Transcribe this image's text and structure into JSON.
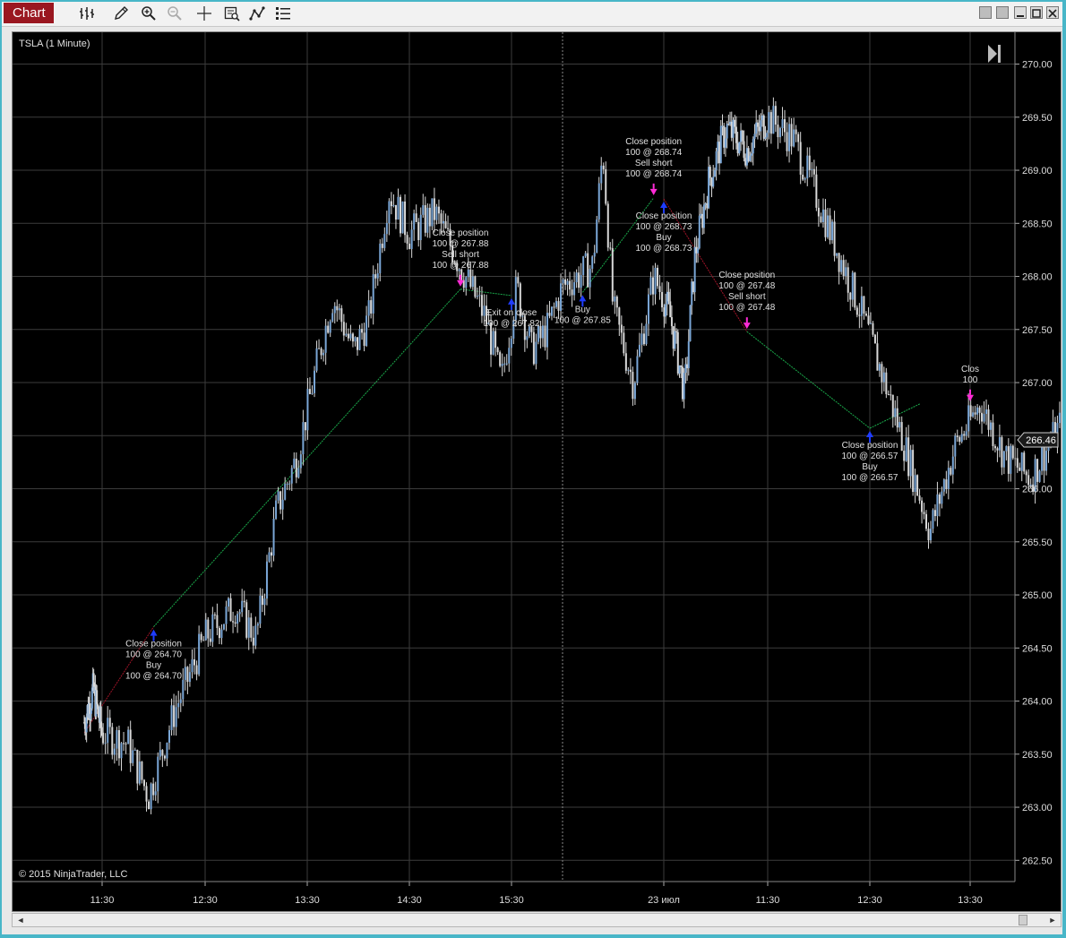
{
  "window": {
    "tab_label": "Chart",
    "toolbar_icons": [
      "bar-type-icon",
      "draw-pencil-icon",
      "zoom-in-icon",
      "zoom-out-icon",
      "crosshair-icon",
      "data-box-icon",
      "strategies-icon",
      "properties-icon"
    ],
    "controls": [
      "color-swatch-icon",
      "color-swatch-icon",
      "minimize-icon",
      "maximize-icon",
      "close-icon"
    ]
  },
  "chart": {
    "instrument_label": "TSLA (1 Minute)",
    "copyright": "© 2015 NinjaTrader, LLC",
    "current_price": "266.46",
    "price_ticks": [
      "270.00",
      "269.50",
      "269.00",
      "268.50",
      "268.00",
      "267.50",
      "267.00",
      "266.50",
      "266.00",
      "265.50",
      "265.00",
      "264.50",
      "264.00",
      "263.50",
      "263.00",
      "262.50"
    ],
    "time_ticks": [
      "11:30",
      "12:30",
      "13:30",
      "14:30",
      "15:30",
      "23 июл",
      "11:30",
      "12:30",
      "13:30"
    ],
    "colors": {
      "background": "#000000",
      "candle_body": "#7aa6d6",
      "wick": "#d8d8d8",
      "buy_marker": "#1f3cff",
      "sell_marker": "#ff2bd6",
      "winning_trade": "#1aa84a",
      "losing_trade": "#a01428",
      "text": "#e0e0e0"
    }
  },
  "chart_data": {
    "type": "candlestick",
    "instrument": "TSLA",
    "interval": "1 Minute",
    "ylim": [
      262.3,
      270.3
    ],
    "y_ticks": [
      262.5,
      263.0,
      263.5,
      264.0,
      264.5,
      265.0,
      265.5,
      266.0,
      266.5,
      267.0,
      267.5,
      268.0,
      268.5,
      269.0,
      269.5,
      270.0
    ],
    "price_path": [
      [
        11.0,
        263.8
      ],
      [
        11.25,
        264.1
      ],
      [
        11.5,
        263.7
      ],
      [
        11.75,
        263.6
      ],
      [
        11.95,
        263.1
      ],
      [
        12.2,
        263.9
      ],
      [
        12.5,
        264.6
      ],
      [
        12.8,
        264.9
      ],
      [
        13.0,
        264.6
      ],
      [
        13.2,
        265.8
      ],
      [
        13.4,
        266.3
      ],
      [
        13.6,
        267.2
      ],
      [
        13.75,
        267.8
      ],
      [
        13.95,
        267.3
      ],
      [
        14.1,
        267.6
      ],
      [
        14.3,
        268.8
      ],
      [
        14.5,
        268.4
      ],
      [
        14.75,
        268.6
      ],
      [
        15.0,
        268.1
      ],
      [
        15.25,
        267.6
      ],
      [
        15.4,
        267.0
      ],
      [
        15.55,
        267.9
      ],
      [
        15.7,
        267.3
      ],
      [
        15.85,
        267.5
      ],
      [
        16.0,
        267.9
      ],
      [
        16.3,
        268.1
      ],
      [
        16.4,
        269.2
      ],
      [
        16.5,
        267.7
      ],
      [
        16.7,
        267.0
      ],
      [
        16.9,
        268.0
      ],
      [
        17.1,
        267.6
      ],
      [
        17.3,
        266.9
      ],
      [
        17.45,
        268.2
      ],
      [
        17.65,
        268.9
      ],
      [
        17.9,
        269.4
      ],
      [
        18.2,
        269.2
      ],
      [
        18.5,
        269.5
      ],
      [
        18.75,
        269.3
      ],
      [
        19.0,
        268.7
      ],
      [
        19.2,
        268.2
      ],
      [
        19.4,
        267.7
      ],
      [
        19.65,
        267.0
      ],
      [
        19.85,
        266.4
      ],
      [
        20.1,
        265.6
      ],
      [
        20.35,
        266.4
      ],
      [
        20.6,
        266.8
      ],
      [
        20.85,
        266.3
      ],
      [
        21.1,
        266.1
      ],
      [
        21.4,
        266.6
      ],
      [
        21.6,
        266.9
      ],
      [
        21.85,
        266.6
      ],
      [
        22.1,
        266.5
      ],
      [
        22.25,
        265.8
      ],
      [
        22.4,
        265.6
      ],
      [
        22.5,
        266.3
      ]
    ],
    "trades": [
      {
        "from": [
          11.0,
          263.7
        ],
        "to": [
          12.0,
          264.7
        ],
        "result": "loss"
      },
      {
        "from": [
          12.0,
          264.7
        ],
        "to": [
          15.0,
          267.88
        ],
        "result": "win"
      },
      {
        "from": [
          15.0,
          267.88
        ],
        "to": [
          15.5,
          267.82
        ],
        "result": "win"
      },
      {
        "from": [
          16.2,
          267.85
        ],
        "to": [
          16.9,
          268.74
        ],
        "result": "win"
      },
      {
        "from": [
          17.0,
          268.73
        ],
        "to": [
          18.2,
          267.48
        ],
        "result": "loss"
      },
      {
        "from": [
          18.2,
          267.48
        ],
        "to": [
          19.5,
          266.57
        ],
        "result": "win"
      },
      {
        "from": [
          19.5,
          266.57
        ],
        "to": [
          20.0,
          266.8
        ],
        "result": "win"
      }
    ],
    "markers": [
      {
        "x": 12.0,
        "y": 264.7,
        "side": "buy",
        "labels": [
          "Close position",
          "100 @ 264.70",
          "Buy",
          "100 @ 264.70"
        ]
      },
      {
        "x": 15.0,
        "y": 267.88,
        "side": "sell",
        "labels": [
          "Close position",
          "100 @ 267.88",
          "Sell short",
          "100 @ 267.88"
        ]
      },
      {
        "x": 15.5,
        "y": 267.82,
        "side": "buy",
        "labels": [
          "Exit on close",
          "100 @ 267.82"
        ]
      },
      {
        "x": 16.2,
        "y": 267.85,
        "side": "buy",
        "labels": [
          "Buy",
          "100 @ 267.85"
        ]
      },
      {
        "x": 16.9,
        "y": 268.74,
        "side": "sell",
        "labels": [
          "Close position",
          "100 @ 268.74",
          "Sell short",
          "100 @ 268.74"
        ]
      },
      {
        "x": 17.0,
        "y": 268.73,
        "side": "buy",
        "labels": [
          "Close position",
          "100 @ 268.73",
          "Buy",
          "100 @ 268.73"
        ]
      },
      {
        "x": 18.2,
        "y": 267.48,
        "side": "sell",
        "labels": [
          "Close position",
          "100 @ 267.48",
          "Sell short",
          "100 @ 267.48"
        ]
      },
      {
        "x": 19.5,
        "y": 266.57,
        "side": "buy",
        "labels": [
          "Close position",
          "100 @ 266.57",
          "Buy",
          "100 @ 266.57"
        ]
      },
      {
        "x": 20.5,
        "y": 266.8,
        "side": "sell",
        "labels": [
          "Clos",
          "100"
        ]
      }
    ]
  }
}
